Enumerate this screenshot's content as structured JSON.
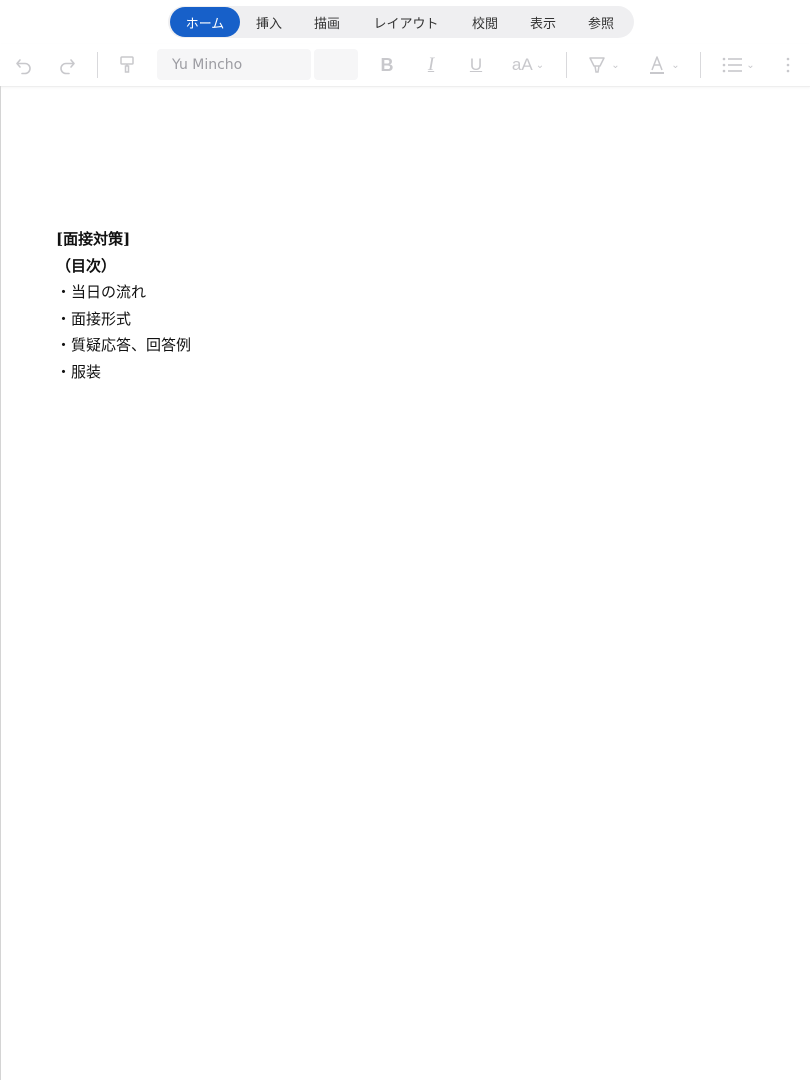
{
  "ribbon": {
    "tabs": [
      {
        "label": "ホーム",
        "active": true
      },
      {
        "label": "挿入",
        "active": false
      },
      {
        "label": "描画",
        "active": false
      },
      {
        "label": "レイアウト",
        "active": false
      },
      {
        "label": "校閲",
        "active": false
      },
      {
        "label": "表示",
        "active": false
      },
      {
        "label": "参照",
        "active": false
      }
    ],
    "accent_color": "#1760c9"
  },
  "toolbar": {
    "font_name": "Yu Mincho",
    "font_size": "",
    "icons": [
      "undo-icon",
      "redo-icon",
      "format-painter-icon",
      "bold-icon",
      "italic-icon",
      "underline-icon",
      "font-size-icon",
      "highlight-icon",
      "font-color-icon",
      "bullet-list-icon",
      "more-icon"
    ],
    "bold_glyph": "B",
    "italic_glyph": "I",
    "underline_glyph": "U",
    "fontsize_glyph": "aA",
    "chevron": "⌄"
  },
  "document": {
    "lines": [
      {
        "text": "[面接対策]",
        "bold": true
      },
      {
        "text": "（目次）",
        "bold": true
      },
      {
        "text": "・当日の流れ",
        "bold": false
      },
      {
        "text": "・面接形式",
        "bold": false
      },
      {
        "text": "・質疑応答、回答例",
        "bold": false
      },
      {
        "text": "・服装",
        "bold": false
      }
    ]
  }
}
